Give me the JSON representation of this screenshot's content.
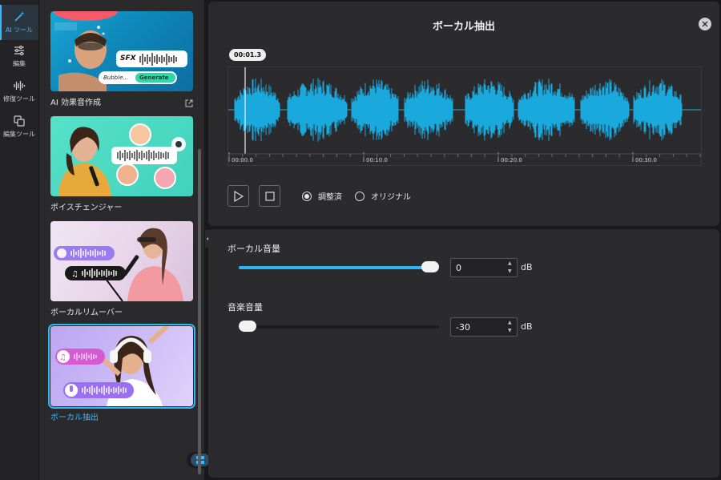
{
  "rail": {
    "items": [
      {
        "label": "AI ツール",
        "icon": "magic-wand-icon"
      },
      {
        "label": "編集",
        "icon": "sliders-icon"
      },
      {
        "label": "修復ツール",
        "icon": "audio-wave-icon"
      },
      {
        "label": "編集ツール",
        "icon": "copy-icon"
      }
    ]
  },
  "tools": {
    "cards": [
      {
        "label": "AI 効果音作成",
        "thumb_text_1": "SFX",
        "thumb_text_2": "Bubble...",
        "thumb_button": "Generate"
      },
      {
        "label": "ボイスチェンジャー"
      },
      {
        "label": "ボーカルリムーバー"
      },
      {
        "label": "ボーカル抽出"
      }
    ]
  },
  "player": {
    "title": "ボーカル抽出",
    "playhead_time": "00:01.3",
    "timeline_ticks": [
      "00:00.0",
      "00:10.0",
      "00:20.0",
      "00:30.0"
    ],
    "radio_adjusted": "調整済",
    "radio_original": "オリジナル",
    "selected_radio": "adjusted"
  },
  "params": {
    "vocal_label": "ボーカル音量",
    "vocal_value": "0",
    "vocal_level": 1.0,
    "music_label": "音楽音量",
    "music_value": "-30",
    "music_level": 0.0,
    "unit": "dB"
  },
  "colors": {
    "accent": "#2fb5f3",
    "waveform": "#19a9dd"
  }
}
